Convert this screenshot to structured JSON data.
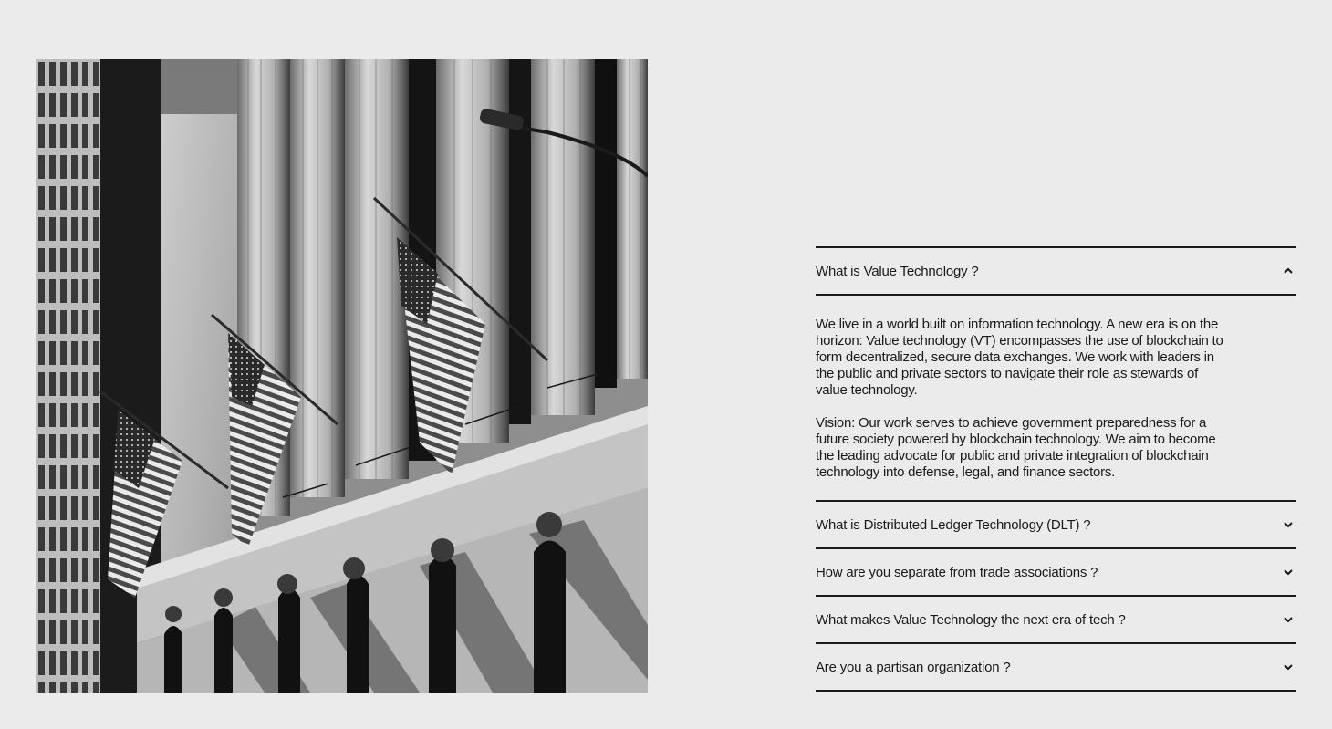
{
  "hero_image": {
    "alt": "Black and white photo of a neoclassical building facade with columns and American flags"
  },
  "faq": {
    "items": [
      {
        "question": "What is Value Technology ?",
        "expanded": true,
        "icon": "chevron-up-icon",
        "answer": [
          "We live in a world built on information technology. A new era is on the horizon: Value technology (VT) encompasses the use of blockchain to form decentralized, secure data exchanges. We work with leaders in the public and private sectors to navigate their role as stewards of value technology.",
          "Vision: Our work serves to achieve government preparedness for a future society powered by blockchain technology. We aim to become the leading advocate for public and private integration of blockchain technology into defense, legal, and finance sectors."
        ]
      },
      {
        "question": "What is Distributed Ledger Technology (DLT) ?",
        "expanded": false,
        "icon": "chevron-down-icon"
      },
      {
        "question": "How are you separate from trade associations ?",
        "expanded": false,
        "icon": "chevron-down-icon"
      },
      {
        "question": "What makes Value Technology the next era of tech ?",
        "expanded": false,
        "icon": "chevron-down-icon"
      },
      {
        "question": "Are you a partisan organization ?",
        "expanded": false,
        "icon": "chevron-down-icon"
      }
    ]
  }
}
